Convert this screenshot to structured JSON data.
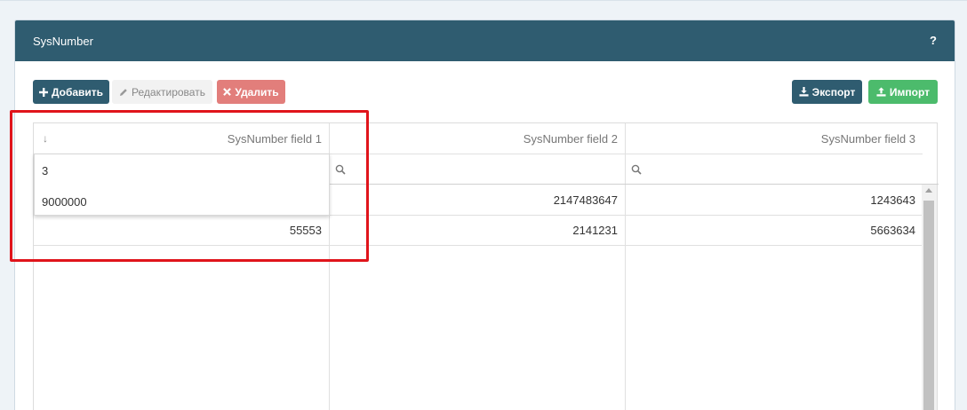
{
  "panel": {
    "title": "SysNumber",
    "help": "?"
  },
  "toolbar": {
    "add_label": "Добавить",
    "edit_label": "Редактировать",
    "delete_label": "Удалить",
    "export_label": "Экспорт",
    "import_label": "Импорт"
  },
  "grid": {
    "columns": [
      "SysNumber field 1",
      "SysNumber field 2",
      "SysNumber field 3"
    ],
    "sort_indicator": "↓",
    "rows": [
      [
        "",
        "2147483647",
        "1243643"
      ],
      [
        "55553",
        "2141231",
        "5663634"
      ]
    ]
  },
  "dropdown": {
    "items": [
      "3",
      "9000000"
    ]
  },
  "colors": {
    "header_bg": "#2f5c70",
    "add_button": "#2f5c70",
    "delete_button": "#d9534f",
    "import_button": "#4cbb6c",
    "highlight": "#e0141b"
  },
  "icons": {
    "help": "question-mark",
    "add": "plus-icon",
    "edit": "pencil-icon",
    "delete": "times-icon",
    "export": "download-icon",
    "import": "upload-icon",
    "filter": "search-icon",
    "sort": "arrow-down-icon"
  }
}
